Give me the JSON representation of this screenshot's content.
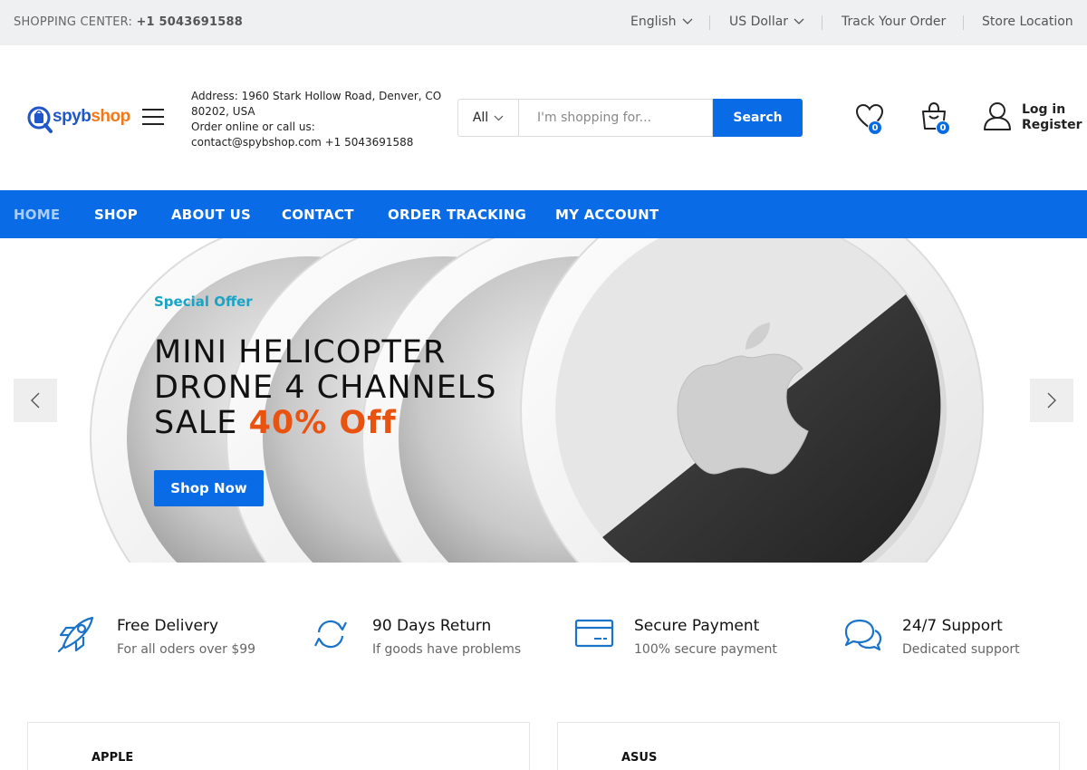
{
  "topbar": {
    "phone_label": "SHOPPING CENTER:",
    "phone_number": "+1 5043691588",
    "language": "English",
    "currency": "US Dollar",
    "track_order": "Track Your Order",
    "store_location": "Store Location"
  },
  "header": {
    "logo_part1": "spyb",
    "logo_part2": "shop",
    "address_line1": "Address: 1960 Stark Hollow Road, Denver, CO 80202, USA",
    "address_line2": "Order online or call us:",
    "address_line3": "contact@spybshop.com +1 5043691588",
    "search": {
      "category": "All",
      "placeholder": "I'm shopping for...",
      "button": "Search"
    },
    "wishlist_count": "0",
    "cart_count": "0",
    "login": "Log in",
    "register": "Register"
  },
  "nav": {
    "items": [
      "HOME",
      "SHOP",
      "ABOUT US",
      "CONTACT",
      "ORDER TRACKING",
      "MY ACCOUNT"
    ]
  },
  "hero": {
    "eyebrow": "Special Offer",
    "title_line1": "MINI HELICOPTER",
    "title_line2": "DRONE 4 CHANNELS",
    "title_line3_prefix": "SALE",
    "title_line3_highlight": "40% Off",
    "cta": "Shop Now"
  },
  "features": [
    {
      "title": "Free Delivery",
      "subtitle": "For all oders over $99",
      "icon": "rocket-icon"
    },
    {
      "title": "90 Days Return",
      "subtitle": "If goods have problems",
      "icon": "refresh-icon"
    },
    {
      "title": "Secure Payment",
      "subtitle": "100% secure payment",
      "icon": "credit-card-icon"
    },
    {
      "title": "24/7 Support",
      "subtitle": "Dedicated support",
      "icon": "chat-bubbles-icon"
    }
  ],
  "brands": [
    "APPLE",
    "ASUS"
  ],
  "colors": {
    "primary": "#0a6be6",
    "accent_orange": "#e8530f",
    "eyebrow_teal": "#1aa3c4",
    "topbar_bg": "#eef0f2"
  }
}
